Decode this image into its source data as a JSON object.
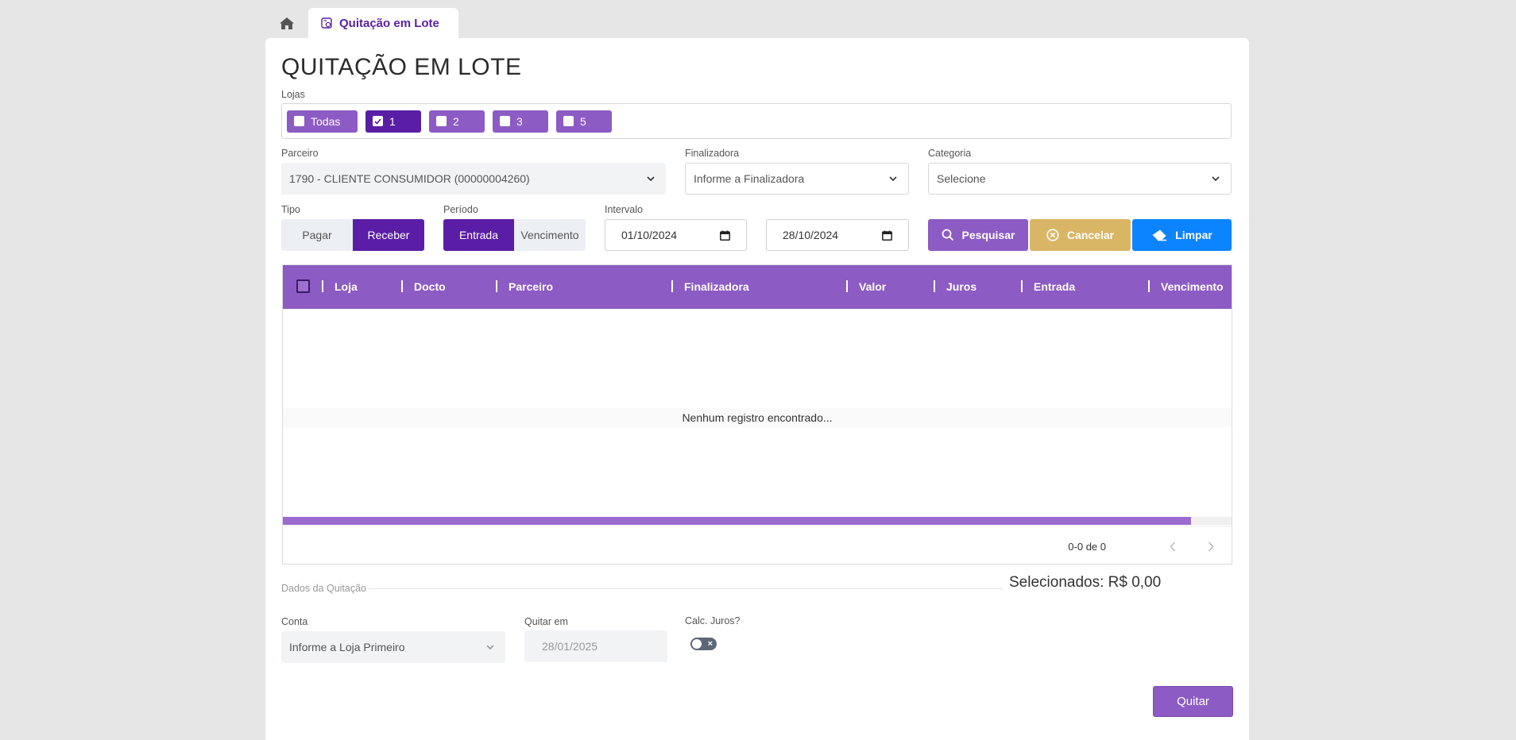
{
  "tabs": {
    "home_icon": "home-icon",
    "active_label": "Quitação em Lote"
  },
  "page": {
    "title": "QUITAÇÃO EM LOTE"
  },
  "lojas": {
    "label": "Lojas",
    "options": [
      {
        "label": "Todas",
        "checked": false
      },
      {
        "label": "1",
        "checked": true
      },
      {
        "label": "2",
        "checked": false
      },
      {
        "label": "3",
        "checked": false
      },
      {
        "label": "5",
        "checked": false
      }
    ]
  },
  "filters": {
    "parceiro_label": "Parceiro",
    "parceiro_value": "1790 - CLIENTE CONSUMIDOR (00000004260)",
    "finalizadora_label": "Finalizadora",
    "finalizadora_placeholder": "Informe a Finalizadora",
    "categoria_label": "Categoria",
    "categoria_placeholder": "Selecione",
    "tipo_label": "Tipo",
    "tipo_options": [
      "Pagar",
      "Receber"
    ],
    "tipo_selected": "Receber",
    "periodo_label": "Período",
    "periodo_options": [
      "Entrada",
      "Vencimento"
    ],
    "periodo_selected": "Entrada",
    "intervalo_label": "Intervalo",
    "date_start": "01/10/2024",
    "date_end": "28/10/2024"
  },
  "actions": {
    "pesquisar": "Pesquisar",
    "cancelar": "Cancelar",
    "limpar": "Limpar"
  },
  "table": {
    "columns": [
      "Loja",
      "Docto",
      "Parceiro",
      "Finalizadora",
      "Valor",
      "Juros",
      "Entrada",
      "Vencimento"
    ],
    "empty_message": "Nenhum registro encontrado...",
    "pagination": "0-0 de 0"
  },
  "quitacao": {
    "section_label": "Dados da Quitação",
    "selected_total": "Selecionados: R$ 0,00",
    "conta_label": "Conta",
    "conta_placeholder": "Informe a Loja Primeiro",
    "quitar_em_label": "Quitar em",
    "quitar_em_value": "28/01/2025",
    "calc_juros_label": "Calc. Juros?",
    "calc_juros_on": false,
    "quitar_button": "Quitar"
  },
  "colors": {
    "primary": "#5a1ea6",
    "accent": "#8c5bc4",
    "warning": "#d9b566",
    "info": "#0d84ff"
  }
}
